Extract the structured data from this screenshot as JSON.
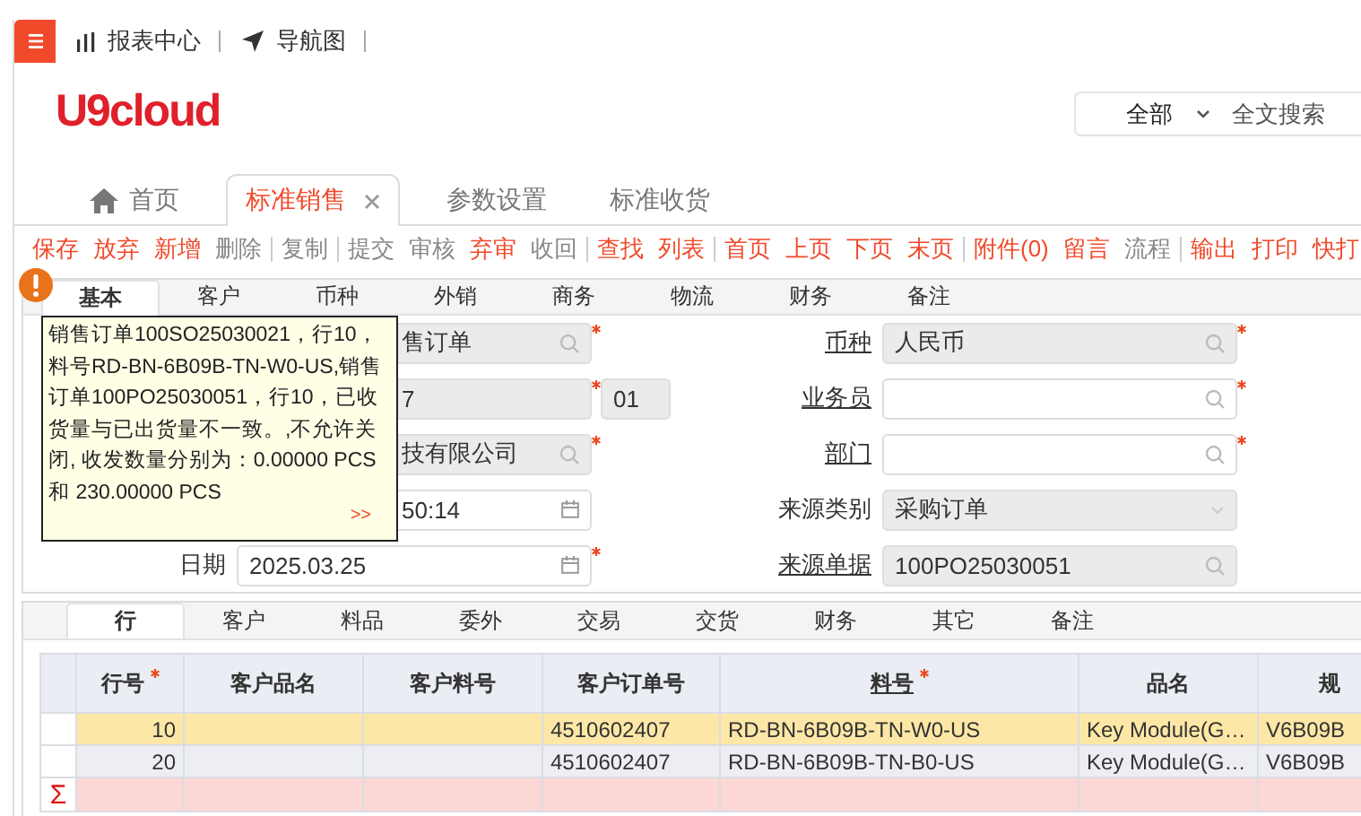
{
  "topbar": {
    "links": [
      {
        "label": "报表中心"
      },
      {
        "label": "导航图"
      }
    ]
  },
  "logo": "U9cloud",
  "search": {
    "scope": "全部",
    "placeholder": "全文搜索"
  },
  "tabs": [
    {
      "label": "首页",
      "kind": "home",
      "selected": false,
      "closable": false
    },
    {
      "label": "标准销售",
      "kind": "page",
      "selected": true,
      "closable": true
    },
    {
      "label": "参数设置",
      "kind": "page",
      "selected": false,
      "closable": false
    },
    {
      "label": "标准收货",
      "kind": "page",
      "selected": false,
      "closable": false
    }
  ],
  "toolbar": [
    {
      "label": "保存",
      "disabled": false,
      "separator_after": false
    },
    {
      "label": "放弃",
      "disabled": false,
      "separator_after": false
    },
    {
      "label": "新增",
      "disabled": false,
      "separator_after": false
    },
    {
      "label": "删除",
      "disabled": true,
      "separator_after": true
    },
    {
      "label": "复制",
      "disabled": true,
      "separator_after": true
    },
    {
      "label": "提交",
      "disabled": true,
      "separator_after": false
    },
    {
      "label": "审核",
      "disabled": true,
      "separator_after": false
    },
    {
      "label": "弃审",
      "disabled": false,
      "separator_after": false
    },
    {
      "label": "收回",
      "disabled": true,
      "separator_after": true
    },
    {
      "label": "查找",
      "disabled": false,
      "separator_after": false
    },
    {
      "label": "列表",
      "disabled": false,
      "separator_after": true
    },
    {
      "label": "首页",
      "disabled": false,
      "separator_after": false
    },
    {
      "label": "上页",
      "disabled": false,
      "separator_after": false
    },
    {
      "label": "下页",
      "disabled": false,
      "separator_after": false
    },
    {
      "label": "末页",
      "disabled": false,
      "separator_after": true
    },
    {
      "label": "附件(0)",
      "disabled": false,
      "separator_after": false
    },
    {
      "label": "留言",
      "disabled": false,
      "separator_after": false
    },
    {
      "label": "流程",
      "disabled": true,
      "separator_after": true
    },
    {
      "label": "输出",
      "disabled": false,
      "separator_after": false
    },
    {
      "label": "打印",
      "disabled": false,
      "separator_after": false
    },
    {
      "label": "快打",
      "disabled": false,
      "separator_after": false
    }
  ],
  "form_tabs": [
    {
      "label": "基本",
      "selected": true
    },
    {
      "label": "客户",
      "selected": false
    },
    {
      "label": "币种",
      "selected": false
    },
    {
      "label": "外销",
      "selected": false
    },
    {
      "label": "商务",
      "selected": false
    },
    {
      "label": "物流",
      "selected": false
    },
    {
      "label": "财务",
      "selected": false
    },
    {
      "label": "备注",
      "selected": false
    }
  ],
  "alert": {
    "message": "销售订单100SO25030021，行10，料号RD-BN-6B09B-TN-W0-US,销售订单100PO25030051，行10，已收货量与已出货量不一致。,不允许关闭, 收发数量分别为：0.00000 PCS 和 230.00000 PCS",
    "more": ">>"
  },
  "left_fields": [
    {
      "value": "售订单",
      "kind": "lookup",
      "disabled": true,
      "required": true
    },
    {
      "value": "7",
      "kind": "text",
      "disabled": true,
      "required": true,
      "extra": "01"
    },
    {
      "value": "技有限公司",
      "kind": "lookup",
      "disabled": true,
      "required": true
    },
    {
      "value": "50:14",
      "kind": "date",
      "disabled": false,
      "required": false
    },
    {
      "label": "日期",
      "value": "2025.03.25",
      "kind": "date",
      "disabled": false,
      "required": true
    }
  ],
  "right_fields": [
    {
      "label": "币种",
      "link": true,
      "value": "人民币",
      "kind": "lookup",
      "disabled": true,
      "required": true
    },
    {
      "label": "业务员",
      "link": true,
      "kind": "lookup",
      "disabled": false,
      "required": true
    },
    {
      "label": "部门",
      "link": true,
      "kind": "lookup",
      "disabled": false,
      "required": true
    },
    {
      "label": "来源类别",
      "link": false,
      "value": "采购订单",
      "kind": "select",
      "disabled": true,
      "required": false
    },
    {
      "label": "来源单据",
      "link": true,
      "value": "100PO25030051",
      "kind": "lookup",
      "disabled": true,
      "required": false
    }
  ],
  "line_tabs": [
    {
      "label": "行",
      "selected": true
    },
    {
      "label": "客户",
      "selected": false
    },
    {
      "label": "料品",
      "selected": false
    },
    {
      "label": "委外",
      "selected": false
    },
    {
      "label": "交易",
      "selected": false
    },
    {
      "label": "交货",
      "selected": false
    },
    {
      "label": "财务",
      "selected": false
    },
    {
      "label": "其它",
      "selected": false
    },
    {
      "label": "备注",
      "selected": false
    }
  ],
  "table": {
    "columns": [
      {
        "label": "行号",
        "required": true,
        "link": false
      },
      {
        "label": "客户品名",
        "required": false,
        "link": false
      },
      {
        "label": "客户料号",
        "required": false,
        "link": false
      },
      {
        "label": "客户订单号",
        "required": false,
        "link": false
      },
      {
        "label": "料号",
        "required": true,
        "link": true
      },
      {
        "label": "品名",
        "required": false,
        "link": false
      },
      {
        "label": "规",
        "required": false,
        "link": false
      }
    ],
    "rows": [
      {
        "selected": true,
        "cells": [
          "10",
          null,
          null,
          "4510602407",
          "RD-BN-6B09B-TN-W0-US",
          "Key Module(G…",
          "V6B09B"
        ]
      },
      {
        "selected": false,
        "cells": [
          "20",
          null,
          null,
          "4510602407",
          "RD-BN-6B09B-TN-B0-US",
          "Key Module(G…",
          "V6B09B"
        ]
      }
    ],
    "sum_row": {
      "symbol": "Σ"
    }
  }
}
